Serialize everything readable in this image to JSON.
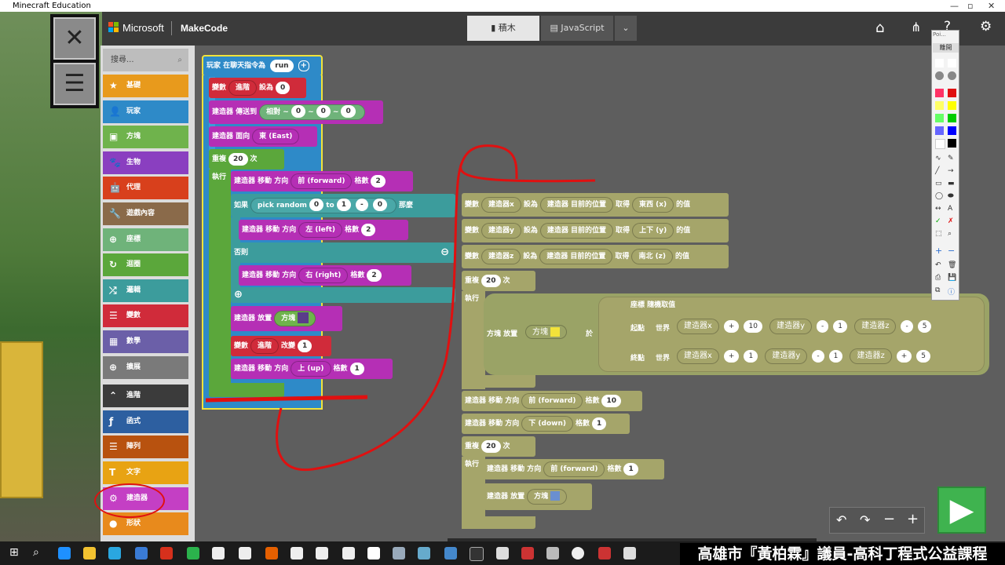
{
  "window": {
    "title": "Minecraft Education"
  },
  "header": {
    "microsoft": "Microsoft",
    "makecode": "MakeCode",
    "tab_blocks": "積木",
    "tab_js": "JavaScript"
  },
  "search": {
    "placeholder": "搜尋..."
  },
  "categories": [
    {
      "label": "基礎",
      "color": "#e89a1c"
    },
    {
      "label": "玩家",
      "color": "#2e8ac8"
    },
    {
      "label": "方塊",
      "color": "#6fb34c"
    },
    {
      "label": "生物",
      "color": "#8a3fc0"
    },
    {
      "label": "代理",
      "color": "#d8401c"
    },
    {
      "label": "遊戲內容",
      "color": "#8a6a4a"
    },
    {
      "label": "座標",
      "color": "#6fb37a"
    },
    {
      "label": "迴圈",
      "color": "#5ba73b"
    },
    {
      "label": "邏輯",
      "color": "#3c9c9c"
    },
    {
      "label": "變數",
      "color": "#d02b3a"
    },
    {
      "label": "數學",
      "color": "#6b5fa8"
    },
    {
      "label": "擴展",
      "color": "#7a7a7a"
    },
    {
      "label": "進階",
      "color": "#3b3b3b"
    },
    {
      "label": "函式",
      "color": "#2d5fa0"
    },
    {
      "label": "陣列",
      "color": "#b8520f"
    },
    {
      "label": "文字",
      "color": "#e8a313"
    },
    {
      "label": "建造器",
      "color": "#c43fc4"
    },
    {
      "label": "形狀",
      "color": "#e88a1c"
    }
  ],
  "blocks": {
    "chat_event": "玩家 在聊天指令為",
    "chat_cmd": "run",
    "var_set": "變數",
    "var_name": "進階",
    "set_to": "設為",
    "zero": "0",
    "builder_teleport": "建造器 傳送到",
    "relative": "相對",
    "tilde": "~",
    "builder_face": "建造器 面向",
    "east": "東 (East)",
    "repeat": "重複",
    "times": "次",
    "do": "執行",
    "twenty": "20",
    "builder_move": "建造器 移動 方向",
    "forward": "前 (forward)",
    "steps": "格數",
    "two": "2",
    "if": "如果",
    "pick_random": "pick random",
    "to": "to",
    "one": "1",
    "minus": "-",
    "then": "那麼",
    "left": "左 (left)",
    "else": "否則",
    "right": "右 (right)",
    "builder_place": "建造器 放置",
    "block": "方塊",
    "change": "改變",
    "up": "上 (up)",
    "var_bx": "建造器x",
    "var_by": "建造器y",
    "var_bz": "建造器z",
    "builder_pos": "建造器 目前的位置",
    "get": "取得",
    "x_axis": "東西 (x)",
    "y_axis": "上下 (y)",
    "z_axis": "南北 (z)",
    "value_of": "的值",
    "fill_place": "方塊 放置",
    "from": "於",
    "rand_pos": "座標 隨機取值",
    "start": "起點",
    "end": "終點",
    "world": "世界",
    "plus": "+",
    "ten": "10",
    "five": "5",
    "ten_steps": "10",
    "down": "下 (down)"
  },
  "paint_panel": {
    "title": "Poi...",
    "close": "離開"
  },
  "overlay": {
    "caption": "高雄市『黃柏霖』議員-高科丁程式公益課程"
  }
}
